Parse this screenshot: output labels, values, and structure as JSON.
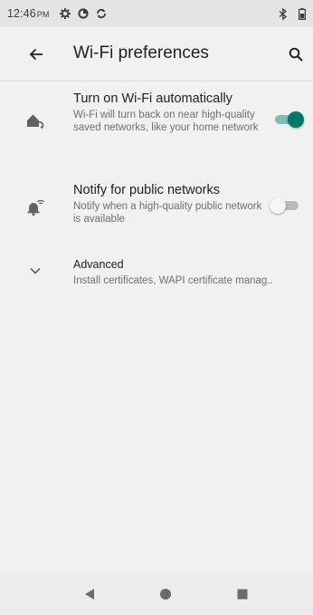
{
  "status_bar": {
    "time": "12:46",
    "ampm": "PM",
    "icons": [
      "settings-gear-icon",
      "data-saver-icon",
      "sync-icon"
    ],
    "right_icons": [
      "bluetooth-icon",
      "battery-icon"
    ]
  },
  "app_bar": {
    "title": "Wi-Fi preferences",
    "back_icon": "arrow-back-icon",
    "search_icon": "search-icon"
  },
  "preferences": [
    {
      "title": "Turn on Wi-Fi automatically",
      "summary": "Wi-Fi will turn back on near high-quality saved networks, like your home network",
      "icon": "wifi-auto-home-icon",
      "toggle": true
    },
    {
      "title": "Notify for public networks",
      "summary": "Notify when a high-quality public network is available",
      "icon": "wifi-notification-icon",
      "toggle": false
    },
    {
      "title": "Advanced",
      "summary": "Install certificates, WAPI certificate manag..",
      "icon": "chevron-down-icon"
    }
  ],
  "nav_bar": {
    "icons": [
      "back-triangle-icon",
      "home-circle-icon",
      "recents-square-icon"
    ]
  },
  "colors": {
    "accent": "#00796b",
    "accent_track": "#7dbdb5",
    "background": "#f1f1f1"
  }
}
